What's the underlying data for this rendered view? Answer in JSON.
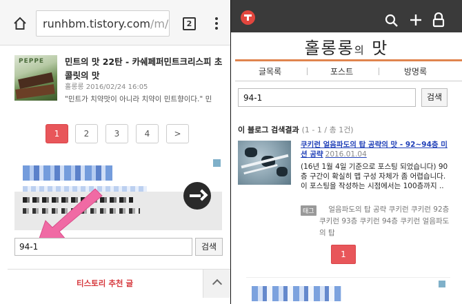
{
  "left": {
    "url_host": "runhbm.tistory.com",
    "url_path": "/m/pos",
    "tab_count": "2",
    "post": {
      "thumb_label": "PEPPE",
      "title": "민트의 맛 22탄 - 카쉐페퍼민트크리스피 초콜릿의 맛",
      "meta": "홀롱롱 2016/02/24 16:05",
      "excerpt": "\"민트가 치약맛이 아니라 치약이 민트향이다.\" 민"
    },
    "pagination": [
      "1",
      "2",
      "3",
      "4"
    ],
    "pagination_active": "1",
    "next_symbol": ">",
    "search": {
      "value": "94-1",
      "button": "검색"
    },
    "recommend_label": "티스토리 추천 글"
  },
  "right": {
    "blog_title_main": "홀롱롱",
    "blog_title_sub": "의",
    "blog_title_end": "맛",
    "nav": [
      "글목록",
      "포스트",
      "방명록"
    ],
    "search": {
      "value": "94-1",
      "button": "검색"
    },
    "result_heading": "이 블로그 검색결과",
    "result_count": "(1 - 1 / 총 1건)",
    "result": {
      "title": "쿠키런 얼음파도의 탑 공략의 맛 - 92~94층 미션 공략",
      "date": "2016.01.04",
      "body": "(16년 1월 4일 기준으로 포스팅 되었습니다) 90층 구간이 확실히 맵 구성 자체가 좀 어렵습니다. 이 포스팅을 작성하는 시점에서는 100층까지 ..",
      "tag_badge": "태그",
      "tags": "얼음파도의 탑 공략 쿠키런 쿠키런 92층 쿠키런 93층 쿠키런 94층 쿠키런 얼음파도의 탑"
    },
    "pagination_active": "1"
  },
  "colors": {
    "accent_red": "#e8565a",
    "link_blue": "#1f3fb8",
    "nav_orange": "#e0844e",
    "arrow_pink": "#f06aa4"
  },
  "icons": [
    "home-icon",
    "tabs-icon",
    "more-icon",
    "tistory-logo-icon",
    "search-icon",
    "plus-icon",
    "lock-icon",
    "arrow-annotation-icon",
    "chevron-up-icon"
  ]
}
